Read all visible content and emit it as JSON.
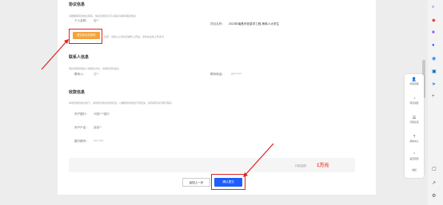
{
  "sections": {
    "agreement": {
      "title": "协议信息",
      "hint": "请根据填写的信息填写，信息有误请与可以联系请填写相关信息",
      "personal_name_label": "个人名称：",
      "personal_name_value": "张**",
      "project_name_label": "项目名称：",
      "project_name_value": "2023年南昌市信息学工程-杨希人大学生",
      "upload_button": "提交协议扫描件",
      "upload_hint": "注意：请将以上协议扫描件上传后，请勿在此处上传多次"
    },
    "contact": {
      "title": "联系人信息",
      "hint": "项目须填写联系人的联系方式，请填写真实信息",
      "contact_label": "联系人：",
      "contact_value": "王**",
      "phone_label": "联系电话：",
      "phone_value": "1*** ****"
    },
    "payment": {
      "title": "收款信息",
      "hint": "本项目收款信息如下，请您核对信息的真实性。以确保您的权益不受损失，如有疑问请与我们联系",
      "bank_label": "开户银行：",
      "bank_value": "中国****银行",
      "account_name_label": "开户户名：",
      "account_name_value": "某某**",
      "account_no_label": "银行账号：",
      "account_no_value": "**** ****"
    }
  },
  "summary": {
    "amount_label": "付款金额：",
    "amount_value": "1万元"
  },
  "actions": {
    "prev_label": "返回上一步",
    "confirm_label": "确认提交"
  },
  "right_panel": {
    "items": [
      {
        "icon": "service-icon",
        "glyph": "👤",
        "label": "智能客服"
      },
      {
        "icon": "progress-icon",
        "glyph": "◔",
        "label": "项目进度"
      },
      {
        "icon": "doc-icon",
        "glyph": "☰",
        "label": "问题反馈"
      },
      {
        "icon": "help-icon",
        "glyph": "?",
        "label": "帮助中心"
      },
      {
        "icon": "top-icon",
        "glyph": "⌃",
        "label": "返回顶部"
      }
    ],
    "close_label": "收起"
  },
  "colors": {
    "accent": "#1e5eff",
    "upload": "#f4a23c",
    "annotation": "#e02020",
    "amount": "#e8453c"
  }
}
